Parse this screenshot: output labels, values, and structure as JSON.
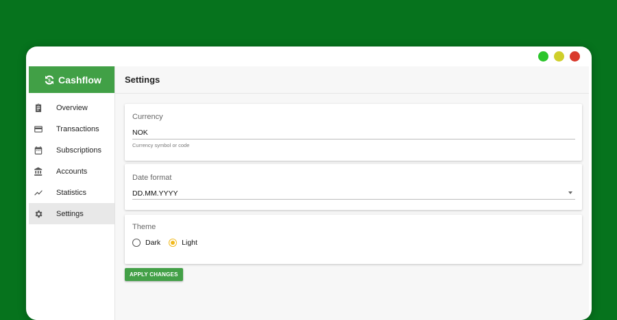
{
  "window": {
    "controls": [
      "green",
      "yellow",
      "red"
    ]
  },
  "brand": {
    "name": "Cashflow",
    "color": "#41a046"
  },
  "sidebar": {
    "items": [
      {
        "label": "Overview",
        "icon": "clipboard-icon"
      },
      {
        "label": "Transactions",
        "icon": "credit-card-icon"
      },
      {
        "label": "Subscriptions",
        "icon": "calendar-icon"
      },
      {
        "label": "Accounts",
        "icon": "bank-icon"
      },
      {
        "label": "Statistics",
        "icon": "trending-line-icon"
      },
      {
        "label": "Settings",
        "icon": "gear-icon",
        "active": true
      }
    ]
  },
  "header": {
    "title": "Settings"
  },
  "currency": {
    "label": "Currency",
    "value": "NOK",
    "help": "Currency symbol or code"
  },
  "date_format": {
    "label": "Date format",
    "value": "DD.MM.YYYY"
  },
  "theme": {
    "label": "Theme",
    "options": [
      {
        "label": "Dark",
        "checked": false
      },
      {
        "label": "Light",
        "checked": true
      }
    ]
  },
  "actions": {
    "apply_label": "APPLY CHANGES"
  },
  "colors": {
    "background": "#06731d",
    "accent": "#43a047",
    "radio_selected": "#f1b91c"
  }
}
